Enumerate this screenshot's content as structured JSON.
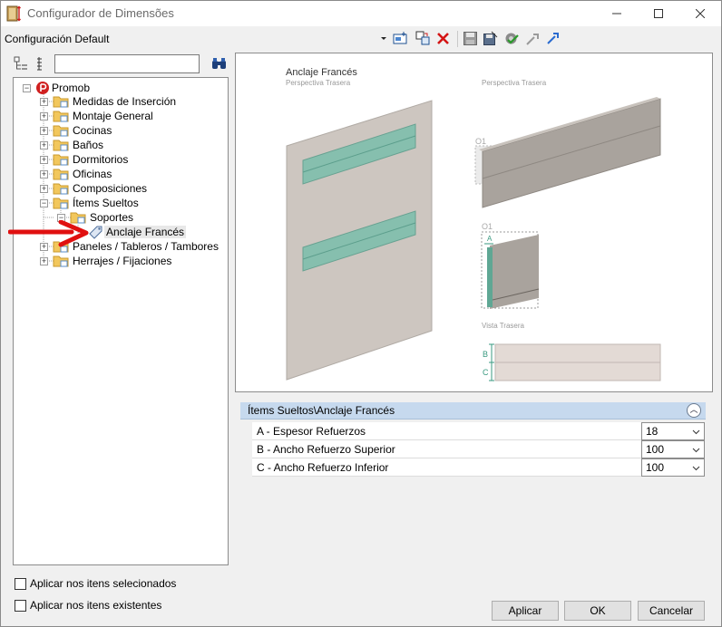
{
  "window": {
    "title": "Configurador de Dimensões"
  },
  "config": {
    "name": "Configuración Default"
  },
  "toolbar": {
    "icons": [
      "new-config-icon",
      "copy-config-icon",
      "delete-icon",
      "save-icon",
      "save-as-icon",
      "apply-check-icon",
      "import-icon",
      "export-icon"
    ],
    "search_value": ""
  },
  "tree": {
    "root": "Promob",
    "items": [
      "Medidas de Inserción",
      "Montaje General",
      "Cocinas",
      "Baños",
      "Dormitorios",
      "Oficinas",
      "Composiciones",
      "Ítems Sueltos",
      "Paneles / Tableros / Tambores",
      "Herrajes / Fijaciones"
    ],
    "child_folder": "Soportes",
    "leaf": "Anclaje Francés"
  },
  "preview": {
    "title": "Anclaje Francés",
    "subtitle_left": "Perspectiva Trasera",
    "subtitle_right": "Perspectiva Trasera",
    "label_o1_top": "O1",
    "label_o1_mid": "O1",
    "label_a": "A",
    "vista_trasera": "Vista Trasera",
    "label_b": "B",
    "label_c": "C"
  },
  "properties": {
    "header": "Ítems Sueltos\\Anclaje Francés",
    "rows": [
      {
        "name": "A - Espesor Refuerzos",
        "value": "18"
      },
      {
        "name": "B - Ancho Refuerzo Superior",
        "value": "100"
      },
      {
        "name": "C - Ancho Refuerzo Inferior",
        "value": "100"
      }
    ]
  },
  "options": {
    "apply_selected": "Aplicar nos itens selecionados",
    "apply_existing": "Aplicar nos itens existentes"
  },
  "buttons": {
    "apply": "Aplicar",
    "ok": "OK",
    "cancel": "Cancelar"
  },
  "colors": {
    "accent_header": "#c6d9ee",
    "reinforcement": "#7fbfad",
    "arrow": "#e01010"
  }
}
